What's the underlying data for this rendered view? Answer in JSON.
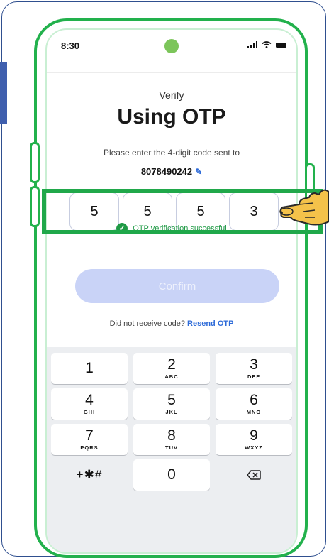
{
  "status_bar": {
    "time": "8:30"
  },
  "header": {
    "subtitle": "Verify",
    "title": "Using OTP"
  },
  "instruction": {
    "text": "Please enter the 4-digit code sent to",
    "phone_number": "8078490242"
  },
  "otp": {
    "digits": [
      "5",
      "5",
      "5",
      "3"
    ]
  },
  "verification": {
    "message": "OTP verification successful",
    "color": "#1f9a45"
  },
  "confirm_button": {
    "label": "Confirm"
  },
  "resend": {
    "prompt": "Did not receive code?",
    "link": "Resend OTP"
  },
  "keypad": {
    "keys": [
      {
        "num": "1",
        "letters": ""
      },
      {
        "num": "2",
        "letters": "ABC"
      },
      {
        "num": "3",
        "letters": "DEF"
      },
      {
        "num": "4",
        "letters": "GHI"
      },
      {
        "num": "5",
        "letters": "JKL"
      },
      {
        "num": "6",
        "letters": "MNO"
      },
      {
        "num": "7",
        "letters": "PQRS"
      },
      {
        "num": "8",
        "letters": "TUV"
      },
      {
        "num": "9",
        "letters": "WXYZ"
      }
    ],
    "symbols_label": "+✱#",
    "zero": "0",
    "backspace_icon": "backspace-icon"
  },
  "colors": {
    "highlight": "#20a84a",
    "phone_outline": "#22b14c",
    "link": "#2e6bd8",
    "confirm_disabled": "#c9d3f7"
  }
}
